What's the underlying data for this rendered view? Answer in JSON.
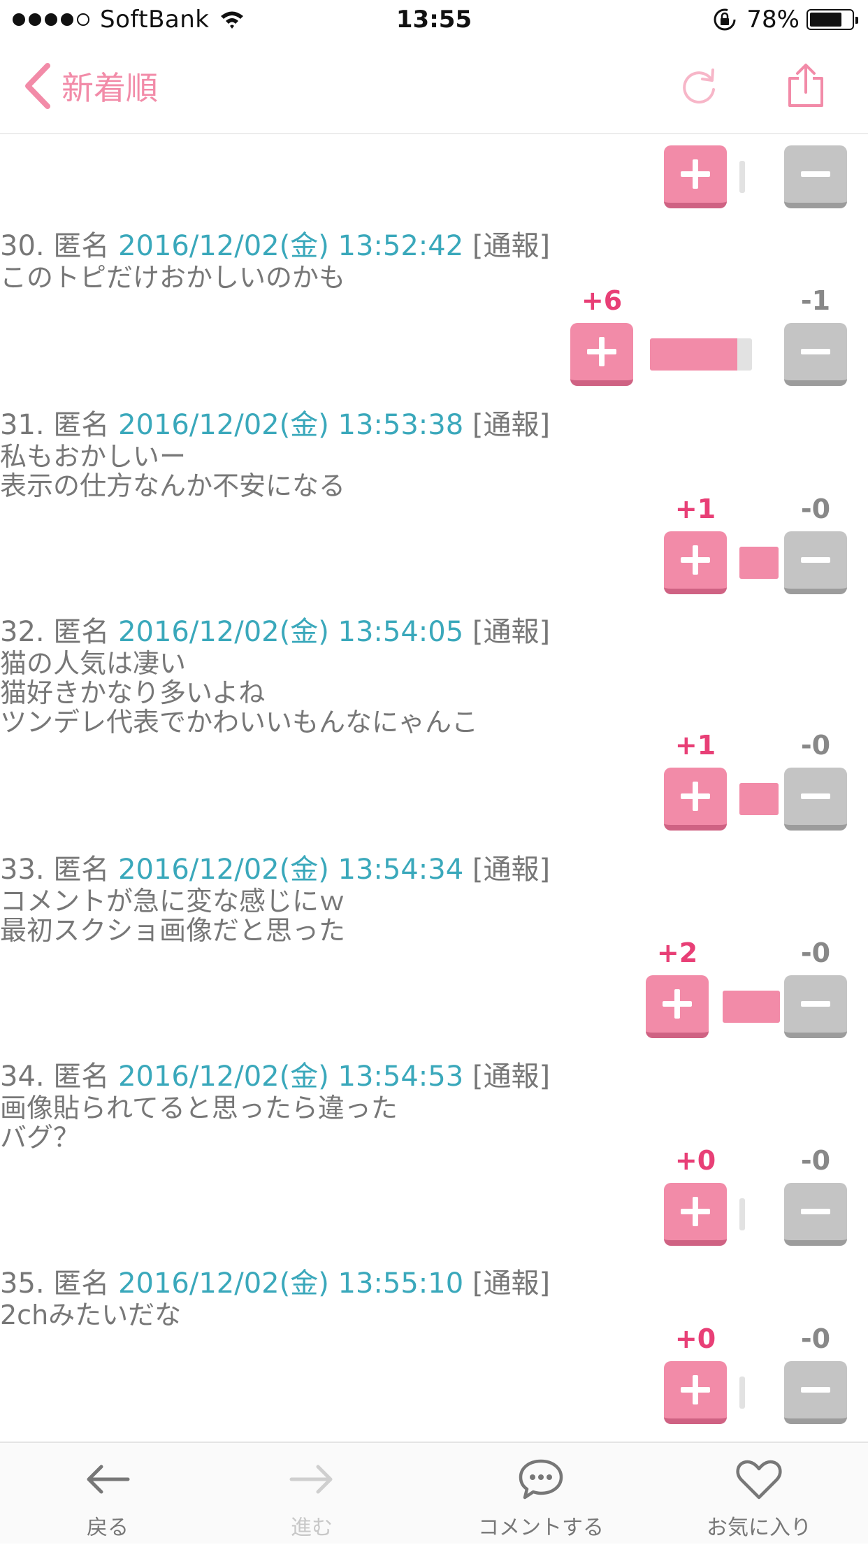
{
  "status": {
    "carrier": "SoftBank",
    "time": "13:55",
    "battery": "78%",
    "battery_level": 0.78
  },
  "nav": {
    "back_label": "新着順"
  },
  "top_vote": {
    "bar_fraction": 0
  },
  "comments": [
    {
      "num": "30.",
      "name": "匿名",
      "date": "2016/12/02(金) 13:52:42",
      "report": "[通報]",
      "text": "このトピだけおかしいのかも",
      "plus": "+6",
      "minus": "-1",
      "plus_share": 0.857
    },
    {
      "num": "31.",
      "name": "匿名",
      "date": "2016/12/02(金) 13:53:38",
      "report": "[通報]",
      "text": "私もおかしいー\n表示の仕方なんか不安になる",
      "plus": "+1",
      "minus": "-0",
      "plus_share": 1
    },
    {
      "num": "32.",
      "name": "匿名",
      "date": "2016/12/02(金) 13:54:05",
      "report": "[通報]",
      "text": "猫の人気は凄い\n猫好きかなり多いよね\nツンデレ代表でかわいいもんなにゃんこ",
      "plus": "+1",
      "minus": "-0",
      "plus_share": 1
    },
    {
      "num": "33.",
      "name": "匿名",
      "date": "2016/12/02(金) 13:54:34",
      "report": "[通報]",
      "text": "コメントが急に変な感じにｗ\n最初スクショ画像だと思った",
      "plus": "+2",
      "minus": "-0",
      "plus_share": 1
    },
    {
      "num": "34.",
      "name": "匿名",
      "date": "2016/12/02(金) 13:54:53",
      "report": "[通報]",
      "text": "画像貼られてると思ったら違った\nバグ？",
      "plus": "+0",
      "minus": "-0",
      "plus_share": 0
    },
    {
      "num": "35.",
      "name": "匿名",
      "date": "2016/12/02(金) 13:55:10",
      "report": "[通報]",
      "text": "2chみたいだな",
      "plus": "+0",
      "minus": "-0",
      "plus_share": 0
    }
  ],
  "toolbar": {
    "back": "戻る",
    "forward": "進む",
    "comment": "コメントする",
    "favorite": "お気に入り"
  },
  "colors": {
    "accent": "#f28ba8",
    "plus_text": "#e83f76",
    "date": "#3aa8bb",
    "minus": "#c4c4c4"
  }
}
